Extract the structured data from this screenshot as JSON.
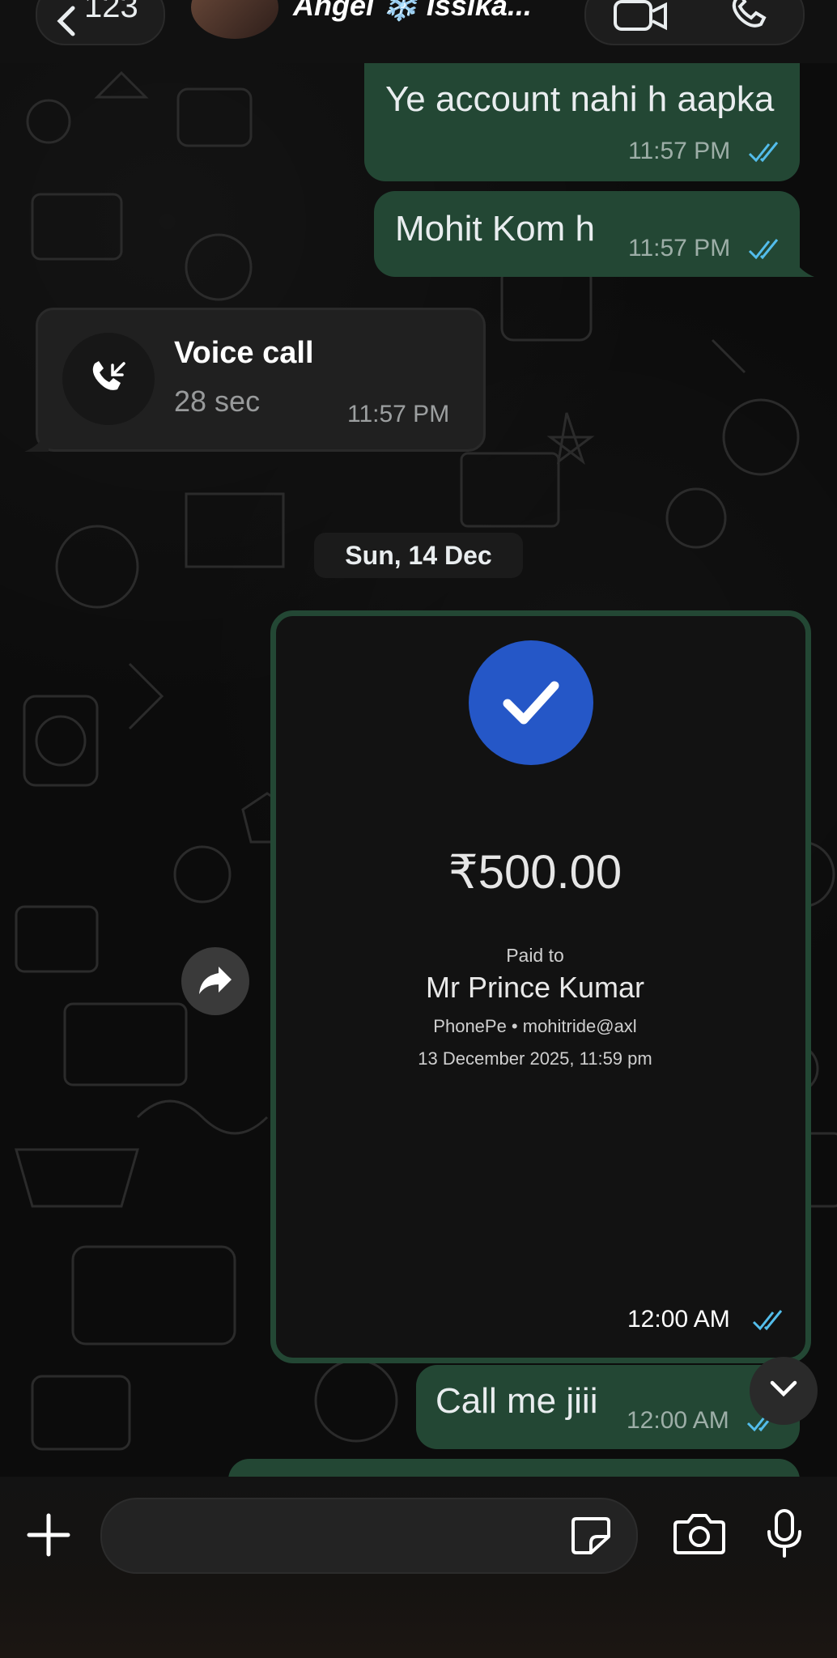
{
  "header": {
    "back_count": "123",
    "contact_name": "Angel ❄️ Issika..."
  },
  "messages": {
    "m1": {
      "text": "Ye account nahi h aapka",
      "time": "11:57 PM"
    },
    "m2": {
      "text": "Mohit Kom h",
      "time": "11:57 PM"
    },
    "call": {
      "title": "Voice call",
      "duration": "28 sec",
      "time": "11:57 PM"
    },
    "date_divider": "Sun, 14 Dec",
    "payment": {
      "amount": "₹500.00",
      "paid_to_label": "Paid to",
      "payee": "Mr Prince Kumar",
      "via": "PhonePe • mohitride@axl",
      "datetime": "13 December 2025, 11:59 pm",
      "time": "12:00 AM"
    },
    "m3": {
      "text": "Call me jiii",
      "time": "12:00 AM"
    }
  },
  "colors": {
    "outgoing_bubble": "#234734",
    "incoming_bubble": "#202020",
    "read_ticks": "#53bdeb",
    "check_circle": "#2557c7"
  },
  "icons": {
    "back": "chevron-left-icon",
    "video": "video-call-icon",
    "phone": "phone-icon",
    "incoming_call": "incoming-call-icon",
    "forward": "forward-icon",
    "scroll_down": "chevron-down-icon",
    "attach": "plus-icon",
    "sticker": "sticker-icon",
    "camera": "camera-icon",
    "mic": "mic-icon"
  }
}
